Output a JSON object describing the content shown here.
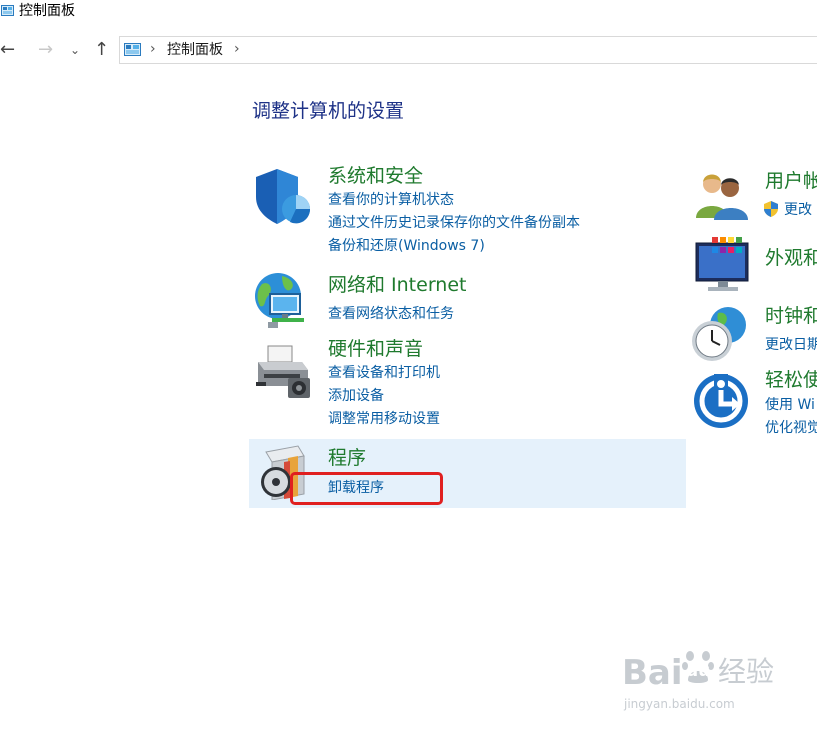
{
  "window": {
    "title": "控制面板"
  },
  "nav": {
    "back": "←",
    "forward": "→",
    "dropdown": "⌄",
    "up": "↑"
  },
  "address": {
    "separator": "›",
    "crumb": "控制面板"
  },
  "page": {
    "heading": "调整计算机的设置"
  },
  "left_categories": [
    {
      "title": "系统和安全",
      "icon": "shield-icon",
      "links": [
        "查看你的计算机状态",
        "通过文件历史记录保存你的文件备份副本",
        "备份和还原(Windows 7)"
      ]
    },
    {
      "title": "网络和 Internet",
      "icon": "network-globe-icon",
      "links": [
        "查看网络状态和任务"
      ]
    },
    {
      "title": "硬件和声音",
      "icon": "printer-icon",
      "links": [
        "查看设备和打印机",
        "添加设备",
        "调整常用移动设置"
      ]
    },
    {
      "title": "程序",
      "icon": "programs-disc-icon",
      "links": [
        "卸载程序"
      ]
    }
  ],
  "right_categories": [
    {
      "title": "用户帐",
      "icon": "users-icon",
      "links": [
        "更改"
      ]
    },
    {
      "title": "外观和",
      "icon": "appearance-monitor-icon",
      "links": []
    },
    {
      "title": "时钟和",
      "icon": "clock-globe-icon",
      "links": [
        "更改日期"
      ]
    },
    {
      "title": "轻松使",
      "icon": "ease-of-access-icon",
      "links": [
        "使用 Wi",
        "优化视觉"
      ]
    }
  ],
  "watermark": {
    "brand_left": "Bai",
    "brand_right": "du",
    "text": "经验",
    "url": "jingyan.baidu.com"
  },
  "colors": {
    "category_title": "#1f7a2e",
    "link": "#0a5ea3",
    "heading": "#1e3287",
    "hover_highlight": "#e5f1fb",
    "annotation_red": "#e02020"
  }
}
